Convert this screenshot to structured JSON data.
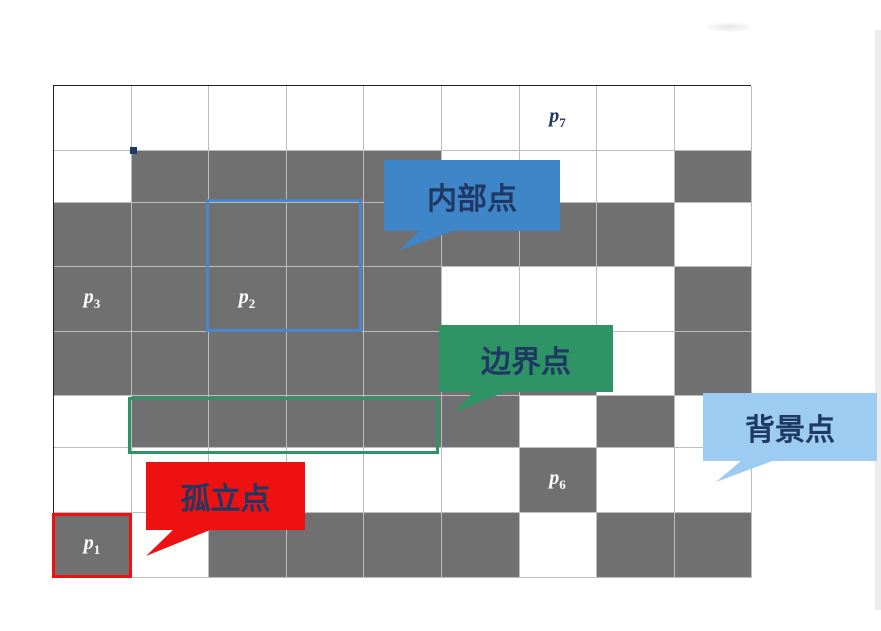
{
  "grid": {
    "rows": [
      [
        0,
        0,
        0,
        0,
        0,
        0,
        0,
        0,
        0
      ],
      [
        0,
        1,
        1,
        1,
        1,
        0,
        0,
        0,
        1
      ],
      [
        1,
        1,
        1,
        1,
        1,
        1,
        1,
        1,
        0
      ],
      [
        1,
        1,
        1,
        1,
        1,
        0,
        0,
        0,
        1
      ],
      [
        1,
        1,
        1,
        1,
        1,
        1,
        1,
        0,
        1
      ],
      [
        0,
        1,
        1,
        1,
        1,
        1,
        0,
        1,
        0
      ],
      [
        0,
        0,
        0,
        0,
        0,
        0,
        1,
        0,
        0
      ],
      [
        1,
        0,
        1,
        1,
        1,
        1,
        0,
        1,
        1
      ]
    ]
  },
  "points": [
    {
      "id": "p7",
      "letter": "p",
      "sub": "7",
      "row": 0,
      "col": 6
    },
    {
      "id": "p3",
      "letter": "p",
      "sub": "3",
      "row": 3,
      "col": 0
    },
    {
      "id": "p2",
      "letter": "p",
      "sub": "2",
      "row": 3,
      "col": 2
    },
    {
      "id": "p6",
      "letter": "p",
      "sub": "6",
      "row": 6,
      "col": 6
    },
    {
      "id": "p1",
      "letter": "p",
      "sub": "1",
      "row": 7,
      "col": 0
    }
  ],
  "callouts": {
    "interior": {
      "text": "内部点",
      "bg": "#3f86c8",
      "color": "#1f3864"
    },
    "boundary": {
      "text": "边界点",
      "bg": "#2e9466",
      "color": "#1f3864"
    },
    "background": {
      "text": "背景点",
      "bg": "#9dccf3",
      "color": "#1f3864"
    },
    "isolated": {
      "text": "孤立点",
      "bg": "#ee1111",
      "color": "#1f3864"
    }
  },
  "highlights": {
    "interior_color": "#4a86c8",
    "boundary_color": "#2e9466",
    "isolated_color": "#ee1111"
  }
}
